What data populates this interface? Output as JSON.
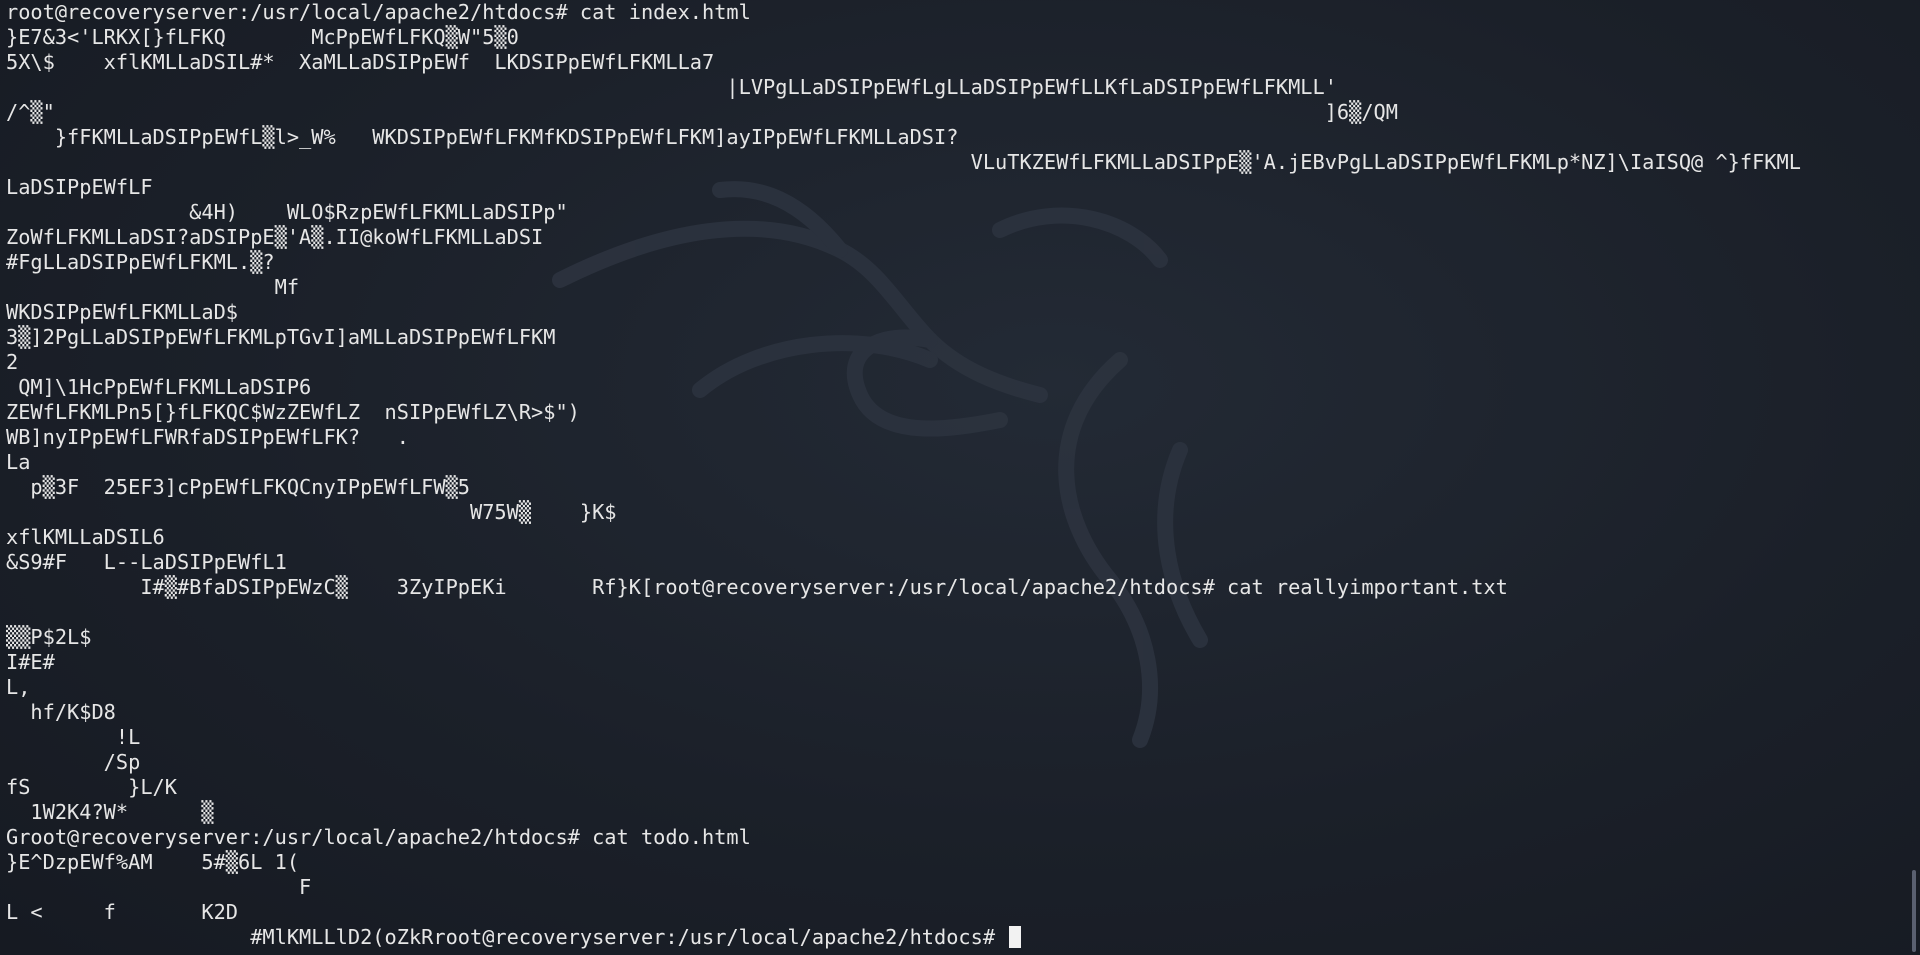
{
  "terminal": {
    "lines": [
      "root@recoveryserver:/usr/local/apache2/htdocs# cat index.html",
      "}E7&3<'LRKX[}fLFKQ       McPpEWfLFKQ▒W\"5▒0",
      "5X\\$    xflKMLLaDSIL#*  XaMLLaDSIPpEWf  LKDSIPpEWfLFKMLLa7",
      "                                                           |LVPgLLaDSIPpEWfLgLLaDSIPpEWfLLKfLaDSIPpEWfLFKMLL'",
      "/^▒\"                                                                                                        ]6▒/QM",
      "    }fFKMLLaDSIPpEWfL▒l>_W%   WKDSIPpEWfLFKMfKDSIPpEWfLFKM]ayIPpEWfLFKMLLaDSI?",
      "                                                                               VLuTKZEWfLFKMLLaDSIPpE▒'A.jEBvPgLLaDSIPpEWfLFKMLp*NZ]\\IaISQ@ ^}fFKML",
      "LaDSIPpEWfLF",
      "               &4H)    WLO$RzpEWfLFKMLLaDSIPp\"",
      "ZoWfLFKMLLaDSI?aDSIPpE▒'A▒.II@koWfLFKMLLaDSI",
      "#FgLLaDSIPpEWfLFKML.▒?",
      "                      Mf",
      "WKDSIPpEWfLFKMLLaD$",
      "3▒]2PgLLaDSIPpEWfLFKMLpTGvI]aMLLaDSIPpEWfLFKM",
      "2",
      " QM]\\1HcPpEWfLFKMLLaDSIP6",
      "ZEWfLFKMLPn5[}fLFKQC$WzZEWfLZ  nSIPpEWfLZ\\R>$\")",
      "WB]nyIPpEWfLFWRfaDSIPpEWfLFK?   .",
      "La",
      "  p▒3F  25EF3]cPpEWfLFKQCnyIPpEWfLFW▒5",
      "                                      W75W▒    }K$",
      "xflKMLLaDSIL6",
      "&S9#F   L--LaDSIPpEWfL1",
      "           I#▒#BfaDSIPpEWzC▒    3ZyIPpEKi       Rf}K[root@recoveryserver:/usr/local/apache2/htdocs# cat reallyimportant.txt",
      "",
      "▒▒P$2L$",
      "I#E#",
      "L,",
      "  hf/K$D8",
      "         !L",
      "        /Sp",
      "fS        }L/K",
      "  1W2K4?W*      ▒",
      "Groot@recoveryserver:/usr/local/apache2/htdocs# cat todo.html",
      "}E^DzpEWf%AM    5#▒6L 1(",
      "                        F",
      "L <     f       K2D"
    ],
    "prompt_line": "                    #MlKMLLlD2(oZkRroot@recoveryserver:/usr/local/apache2/htdocs# "
  },
  "colors": {
    "background": "#1b2029",
    "text": "#e6e6e6",
    "cursor": "#f2f2f2",
    "wallpaper_art": "#2c333f"
  },
  "icons": {
    "wallpaper": "kali-dragon-icon"
  }
}
